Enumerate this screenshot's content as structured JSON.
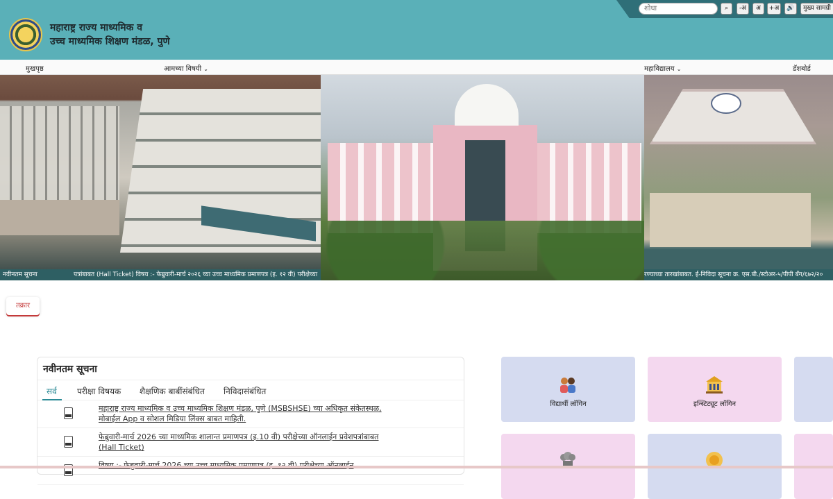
{
  "header": {
    "org_name_line1": "महाराष्ट्र राज्य माध्यमिक व",
    "org_name_line2": "उच्च माध्यमिक शिक्षण मंडळ, पुणे",
    "header_color": "#5ab0b8"
  },
  "utility": {
    "search_placeholder": "शोधा",
    "buttons": [
      "-अ",
      "अ",
      "+अ",
      "मुख्य सामग्री"
    ],
    "search_icon": "search-icon",
    "audio_icon": "speaker-icon"
  },
  "nav": {
    "items": [
      "मुखपृष्ठ",
      "आमच्या विषयी",
      "महाविद्यालय",
      "डॅशबोर्ड"
    ]
  },
  "ticker": {
    "label": "नवीनतम सूचना",
    "text1": "पत्रांबाबत (Hall Ticket) विषय :- फेब्रुवारी-मार्च २०२६ च्या उच्च माध्यमिक प्रमाणपत्र (इ. १२ वी) परीक्षेच्या",
    "text2": "रण्याच्या तारखांबाबत. ई-निविदा सूचना क्र. एस.बी./स्टोअर-५/पीपी बँग/६७२/२०"
  },
  "complaint": {
    "label": "तक्रार"
  },
  "notices": {
    "title": "नवीनतम सूचना",
    "tabs": [
      "सर्व",
      "परीक्षा विषयक",
      "शैक्षणिक बाबींसंबंधित",
      "निविदासंबंधित"
    ],
    "items": [
      {
        "line1": "महाराष्ट्र राज्य माध्यमिक व उच्च माध्यमिक शिक्षण मंडळ, पुणे (MSBSHSE) च्या अधिकृत संकेतस्थळ,",
        "line2": "मोबाईल App व सोशल मिडिया लिंक्स बाबत माहिती."
      },
      {
        "line1": "फेब्रुवारी-मार्च 2026 च्या माध्यमिक शालान्त प्रमाणपत्र (इ.10 वी) परीक्षेच्या ऑनलाईन प्रवेशपत्रांबाबत",
        "line2": "(Hall Ticket)"
      },
      {
        "line1": "विषय :- फेब्रुवारी-मार्च 2026 च्या उच्च माध्यमिक प्रमाणपत्र (इ. १२ वी) परीक्षेच्या ऑनलाईन",
        "line2": ""
      }
    ]
  },
  "tiles": [
    {
      "label": "विद्यार्थी लॉगिन",
      "color": "#d5dbf0",
      "icon": "students-icon"
    },
    {
      "label": "इन्स्टिट्यूट लॉगिन",
      "color": "#f4d8ef",
      "icon": "institute-icon"
    },
    {
      "label": "",
      "color": "#d5dbf0",
      "icon": ""
    },
    {
      "label": "",
      "color": "#f4d8ef",
      "icon": "emblem-icon"
    },
    {
      "label": "",
      "color": "#d5dbf0",
      "icon": "sun-icon"
    },
    {
      "label": "",
      "color": "#f4d8ef",
      "icon": ""
    }
  ]
}
